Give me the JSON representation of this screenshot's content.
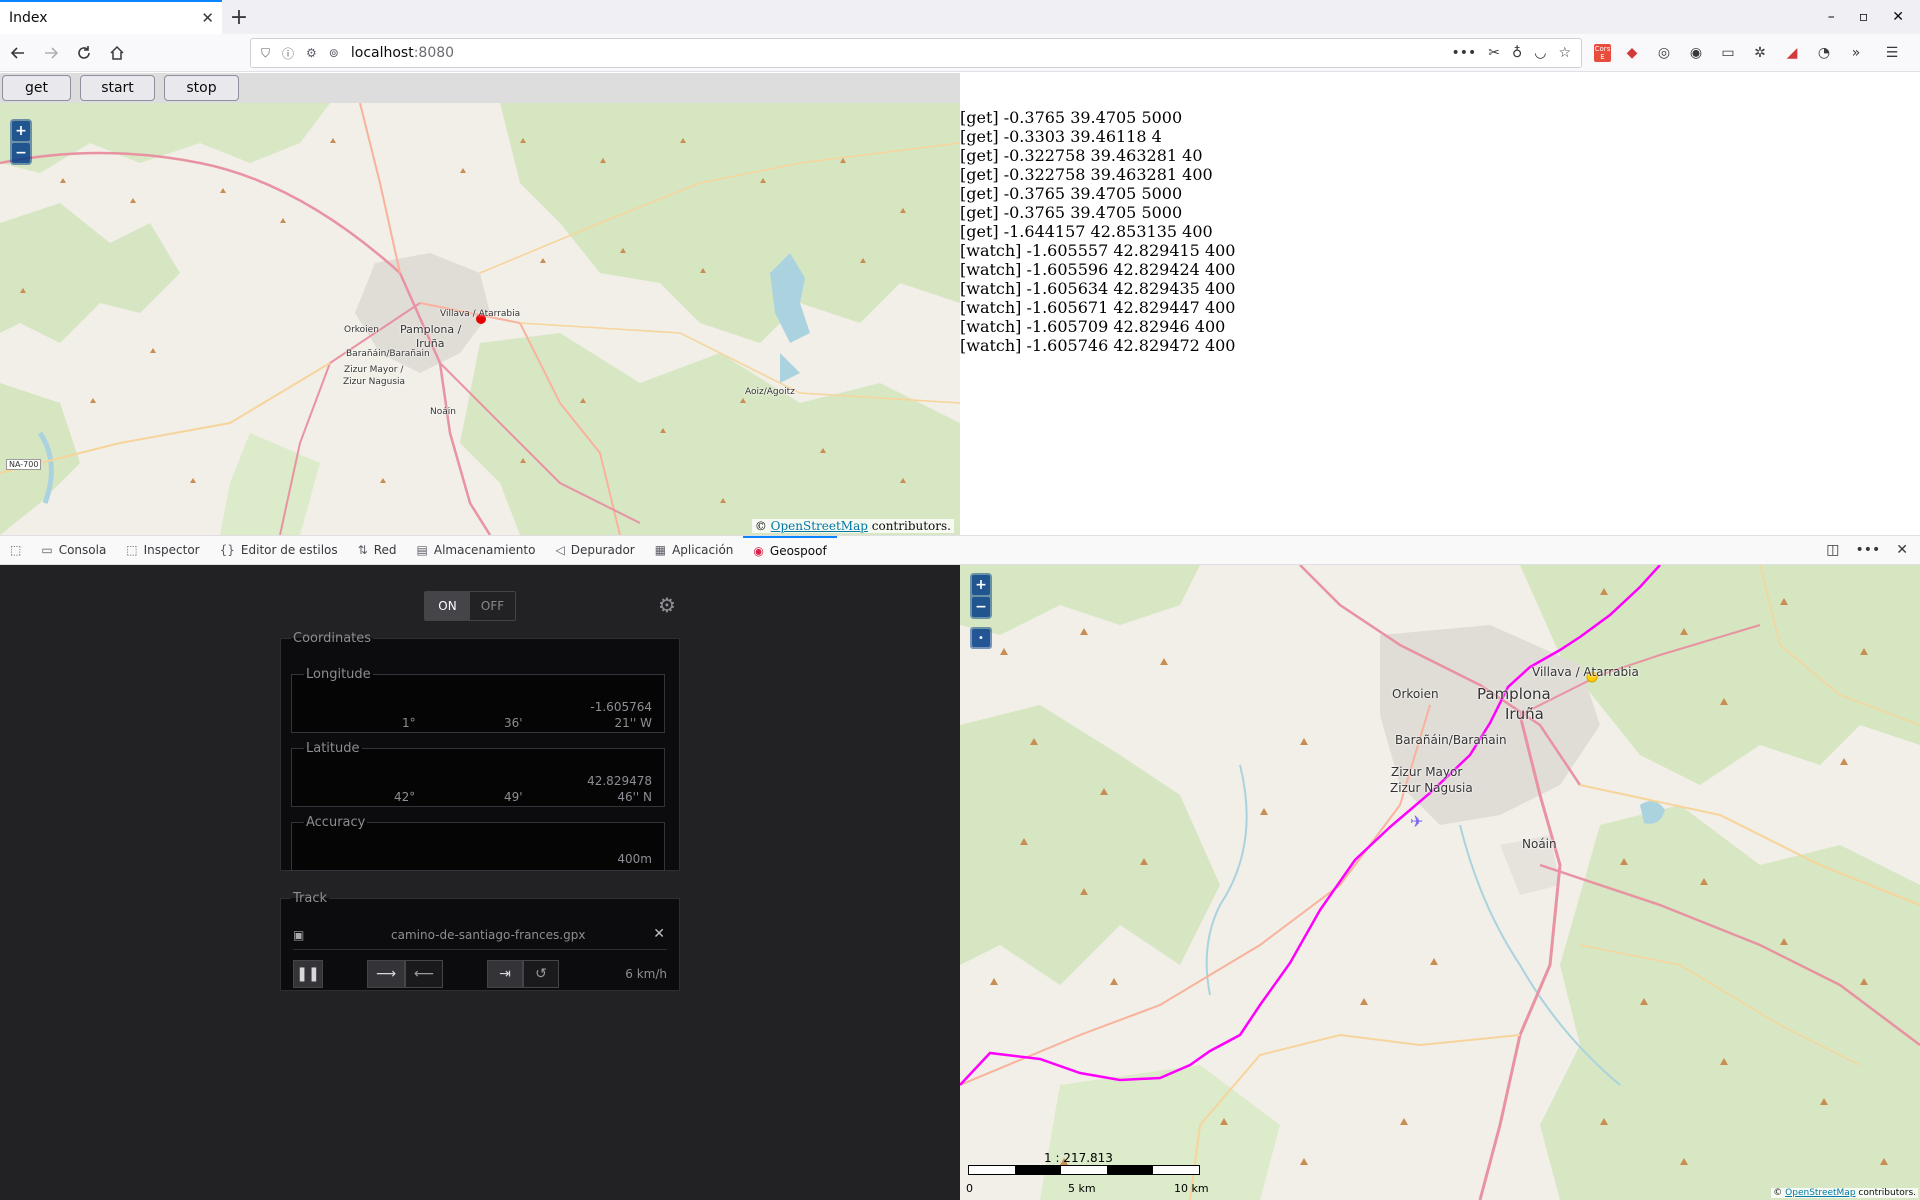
{
  "browser": {
    "tab_title": "Index",
    "tab_close": "✕",
    "new_tab": "+",
    "url_host": "localhost",
    "url_port": ":8080",
    "window_controls": [
      "–",
      "▫",
      "✕"
    ]
  },
  "page": {
    "buttons": {
      "get": "get",
      "start": "start",
      "stop": "stop"
    },
    "map": {
      "zoom_in": "+",
      "zoom_out": "−",
      "attribution_prefix": "© ",
      "attribution_link": "OpenStreetMap",
      "attribution_suffix": " contributors.",
      "labels": {
        "villava": "Villava / Atarrabia",
        "pamplona": "Pamplona /",
        "iruna": "Iruña",
        "orkoien": "Orkoien",
        "baranain": "Barañáin/Barañain",
        "zizur1": "Zizur Mayor /",
        "zizur2": "Zizur Nagusia",
        "noain": "Noáin",
        "aoiz": "Aoiz/Agoitz",
        "na700": "NA-700"
      }
    },
    "log": [
      "[get] -0.3765 39.4705 5000",
      "[get] -0.3303 39.46118 4",
      "[get] -0.322758 39.463281 40",
      "[get] -0.322758 39.463281 400",
      "[get] -0.3765 39.4705 5000",
      "[get] -0.3765 39.4705 5000",
      "[get] -1.644157 42.853135 400",
      "[watch] -1.605557 42.829415 400",
      "[watch] -1.605596 42.829424 400",
      "[watch] -1.605634 42.829435 400",
      "[watch] -1.605671 42.829447 400",
      "[watch] -1.605709 42.82946 400",
      "[watch] -1.605746 42.829472 400"
    ]
  },
  "devtools": {
    "tabs": [
      {
        "label": "Consola",
        "icon": "console-icon"
      },
      {
        "label": "Inspector",
        "icon": "inspector-icon"
      },
      {
        "label": "Editor de estilos",
        "icon": "braces-icon"
      },
      {
        "label": "Red",
        "icon": "network-icon"
      },
      {
        "label": "Almacenamiento",
        "icon": "storage-icon"
      },
      {
        "label": "Depurador",
        "icon": "debugger-icon"
      },
      {
        "label": "Aplicación",
        "icon": "application-icon"
      },
      {
        "label": "Geospoof",
        "icon": "geospoof-icon"
      }
    ],
    "active_tab": "Geospoof"
  },
  "geospoof": {
    "toggle_on": "ON",
    "toggle_off": "OFF",
    "coordinates_legend": "Coordinates",
    "longitude": {
      "legend": "Longitude",
      "value": "-1.605764",
      "deg": "1°",
      "min": "36'",
      "sec": "21'' W"
    },
    "latitude": {
      "legend": "Latitude",
      "value": "42.829478",
      "deg": "42°",
      "min": "49'",
      "sec": "46'' N"
    },
    "accuracy": {
      "legend": "Accuracy",
      "value": "400m"
    },
    "track": {
      "legend": "Track",
      "file": "camino-de-santiago-frances.gpx",
      "speed": "6 km/h",
      "playing": true
    },
    "map": {
      "zoom_in": "+",
      "zoom_out": "−",
      "locate": "•",
      "scale_text": "1 : 217.813",
      "scale_labels": [
        "0",
        "5 km",
        "10 km"
      ],
      "attribution_prefix": "© ",
      "attribution_link": "OpenStreetMap",
      "attribution_suffix": " contributors.",
      "labels": {
        "villava": "Villava / Atarrabia",
        "pamplona": "Pamplona",
        "iruna": "Iruña",
        "orkoien": "Orkoien",
        "baranain": "Barañáin/Barañain",
        "zizur1": "Zizur Mayor",
        "zizur2": "Zizur Nagusia",
        "noain": "Noáin"
      }
    }
  }
}
